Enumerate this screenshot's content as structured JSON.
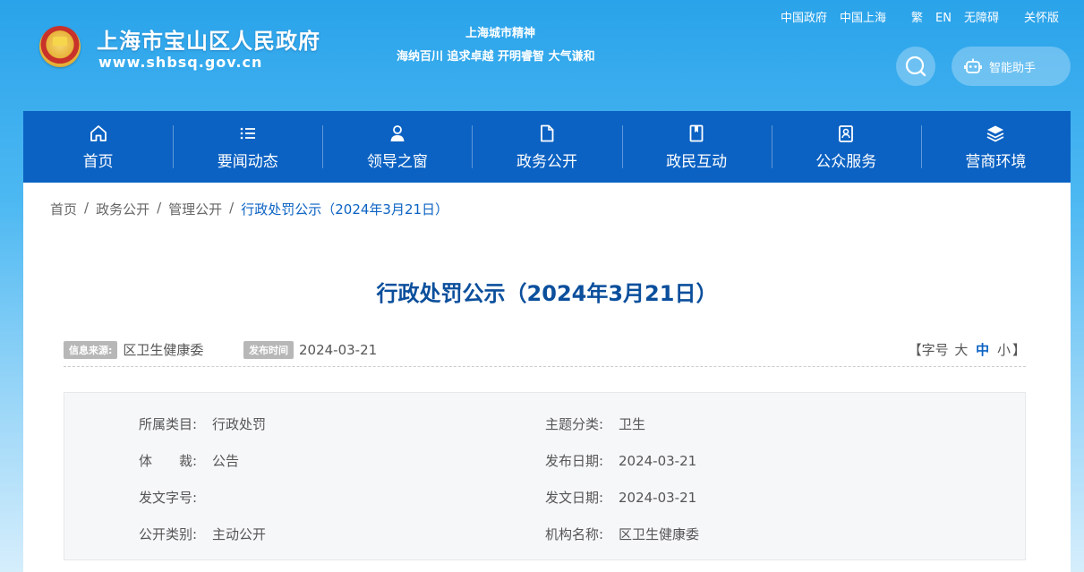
{
  "header": {
    "site_title": "上海市宝山区人民政府",
    "site_url": "www.shbsq.gov.cn",
    "spirit_title": "上海城市精神",
    "spirit_text": "海纳百川 追求卓越 开明睿智 大气谦和",
    "top_links": [
      "中国政府",
      "中国上海",
      "繁",
      "EN",
      "无障碍",
      "关怀版"
    ],
    "assistant_label": "智能助手"
  },
  "nav": {
    "items": [
      {
        "label": "首页",
        "icon": "home-icon"
      },
      {
        "label": "要闻动态",
        "icon": "list-icon"
      },
      {
        "label": "领导之窗",
        "icon": "person-icon"
      },
      {
        "label": "政务公开",
        "icon": "document-icon"
      },
      {
        "label": "政民互动",
        "icon": "bookmark-icon"
      },
      {
        "label": "公众服务",
        "icon": "service-icon"
      },
      {
        "label": "营商环境",
        "icon": "layers-icon"
      }
    ]
  },
  "breadcrumb": {
    "items": [
      "首页",
      "政务公开",
      "管理公开"
    ],
    "current": "行政处罚公示（2024年3月21日）",
    "separator": "/"
  },
  "article": {
    "title": "行政处罚公示（2024年3月21日）",
    "source_tag": "信息来源:",
    "source_value": "区卫生健康委",
    "date_tag": "发布时间",
    "date_value": "2024-03-21",
    "fontsize": {
      "open": "【字号",
      "large": "大",
      "medium": "中",
      "small": "小",
      "close": "】"
    }
  },
  "info": {
    "rows": [
      {
        "key": "所属类目:",
        "value": "行政处罚"
      },
      {
        "key": "主题分类:",
        "value": "卫生"
      },
      {
        "key": "体　　裁:",
        "value": "公告"
      },
      {
        "key": "发布日期:",
        "value": "2024-03-21"
      },
      {
        "key": "发文字号:",
        "value": ""
      },
      {
        "key": "发文日期:",
        "value": "2024-03-21"
      },
      {
        "key": "公开类别:",
        "value": "主动公开"
      },
      {
        "key": "机构名称:",
        "value": "区卫生健康委"
      }
    ]
  },
  "colors": {
    "nav_bg": "#0b62c3",
    "title_color": "#0b4f9c",
    "accent": "#0b62c3"
  }
}
